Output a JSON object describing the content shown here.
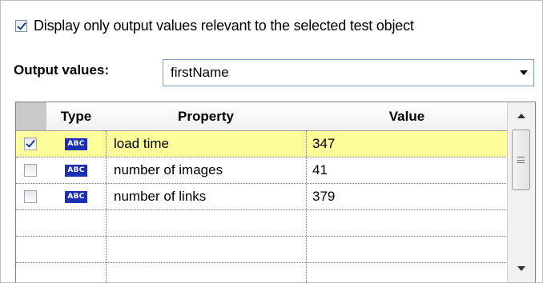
{
  "display_only": {
    "checked": true,
    "label": "Display only output values relevant to the selected test object"
  },
  "output_values": {
    "label": "Output values:",
    "selected": "firstName"
  },
  "table": {
    "columns": [
      "Type",
      "Property",
      "Value"
    ],
    "rows": [
      {
        "checked": true,
        "type_icon": "abc-string-icon",
        "type_label": "ABC",
        "property": "load time",
        "value": "347",
        "highlighted": true
      },
      {
        "checked": false,
        "type_icon": "abc-string-icon",
        "type_label": "ABC",
        "property": "number of images",
        "value": "41",
        "highlighted": false
      },
      {
        "checked": false,
        "type_icon": "abc-string-icon",
        "type_label": "ABC",
        "property": "number of links",
        "value": "379",
        "highlighted": false
      }
    ]
  },
  "colors": {
    "highlight_row": "#fdfd9a",
    "type_icon_bg": "#1a2fb3",
    "checkmark": "#1d3f93"
  }
}
